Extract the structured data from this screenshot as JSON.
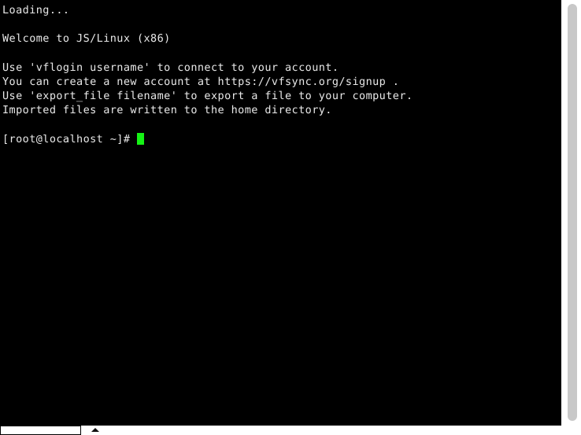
{
  "terminal": {
    "lines": [
      "Loading...",
      "",
      "Welcome to JS/Linux (x86)",
      "",
      "Use 'vflogin username' to connect to your account.",
      "You can create a new account at https://vfsync.org/signup .",
      "Use 'export_file filename' to export a file to your computer.",
      "Imported files are written to the home directory.",
      ""
    ],
    "prompt": "[root@localhost ~]# ",
    "cursor": "block-cursor",
    "colors": {
      "background": "#000000",
      "foreground": "#e8e8e8",
      "cursor": "#15f215"
    }
  },
  "bottom_bar": {
    "input_value": "",
    "input_placeholder": "",
    "caret_icon": "triangle-up-icon"
  },
  "scrollbar": {
    "icon": "vertical-scrollbar",
    "thumb_color": "#c8c8c8",
    "track_color": "#ffffff"
  }
}
